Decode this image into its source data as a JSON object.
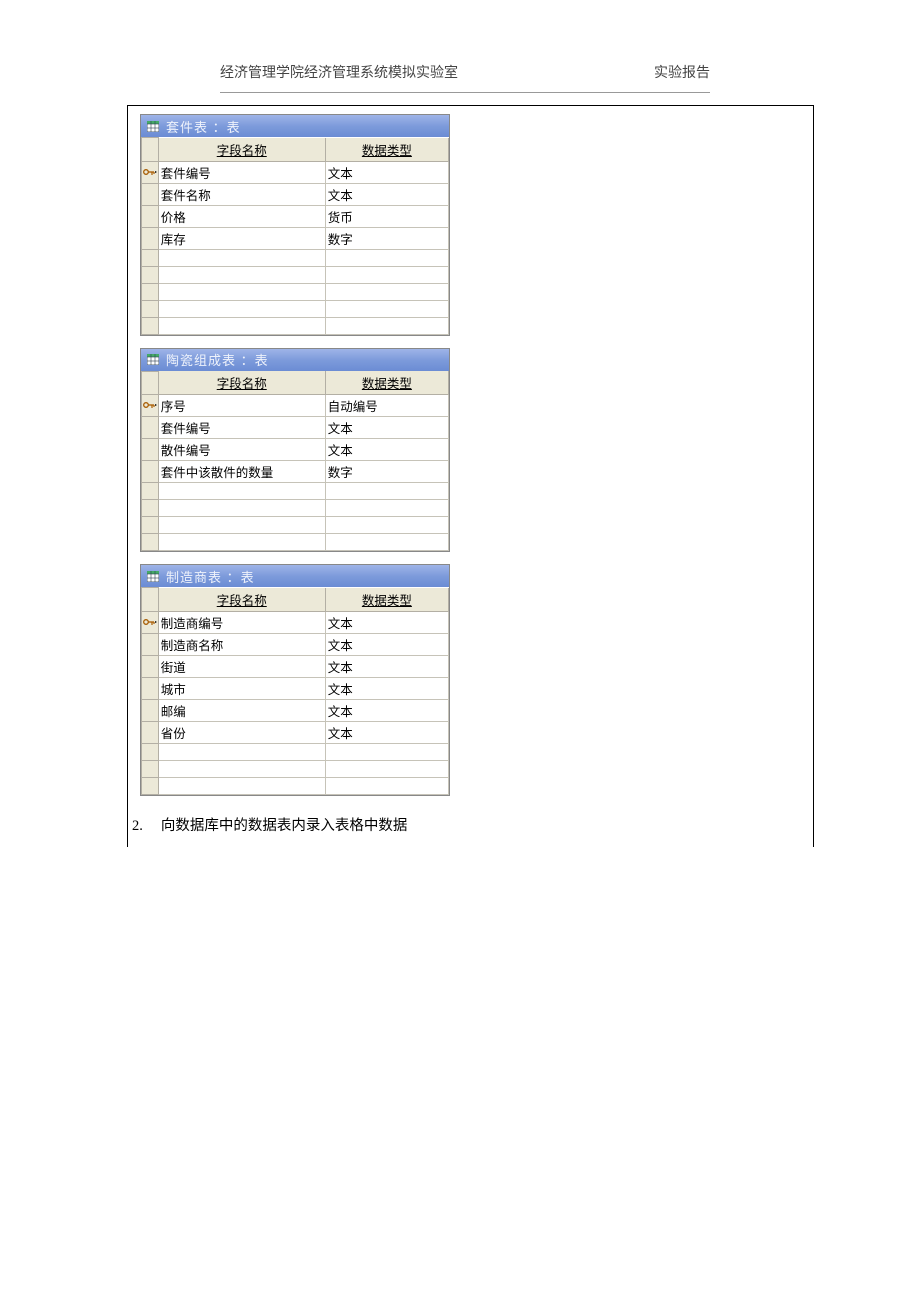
{
  "header": {
    "left": "经济管理学院经济管理系统模拟实验室",
    "right": "实验报告"
  },
  "common": {
    "col_field_name": "字段名称",
    "col_data_type": "数据类型"
  },
  "tables": [
    {
      "title": "套件表 ：表",
      "rows": [
        {
          "key": true,
          "field": "套件编号",
          "type": "文本"
        },
        {
          "key": false,
          "field": "套件名称",
          "type": "文本"
        },
        {
          "key": false,
          "field": "价格",
          "type": "货币"
        },
        {
          "key": false,
          "field": "库存",
          "type": "数字"
        }
      ],
      "empty_rows": 5
    },
    {
      "title": "陶瓷组成表 ：表",
      "rows": [
        {
          "key": true,
          "field": "序号",
          "type": "自动编号"
        },
        {
          "key": false,
          "field": "套件编号",
          "type": "文本"
        },
        {
          "key": false,
          "field": "散件编号",
          "type": "文本"
        },
        {
          "key": false,
          "field": "套件中该散件的数量",
          "type": "数字"
        }
      ],
      "empty_rows": 4
    },
    {
      "title": "制造商表 ：表",
      "rows": [
        {
          "key": true,
          "field": "制造商编号",
          "type": "文本"
        },
        {
          "key": false,
          "field": "制造商名称",
          "type": "文本"
        },
        {
          "key": false,
          "field": "街道",
          "type": "文本"
        },
        {
          "key": false,
          "field": "城市",
          "type": "文本"
        },
        {
          "key": false,
          "field": "邮编",
          "type": "文本"
        },
        {
          "key": false,
          "field": "省份",
          "type": "文本"
        }
      ],
      "empty_rows": 3
    }
  ],
  "footer": {
    "num": "2.",
    "text": "向数据库中的数据表内录入表格中数据"
  }
}
